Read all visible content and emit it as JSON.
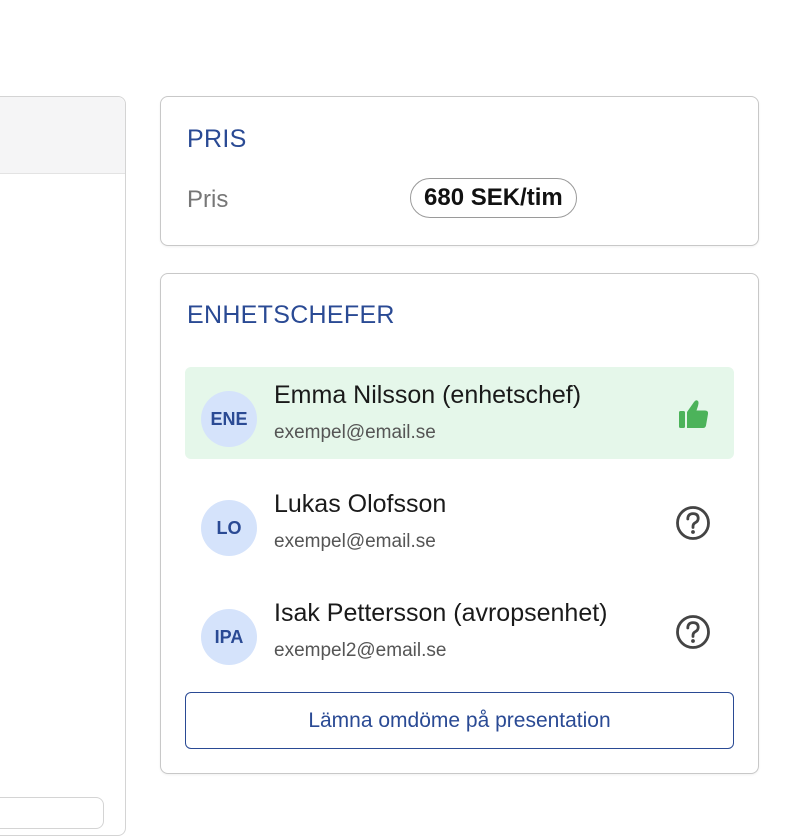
{
  "price_card": {
    "title": "PRIS",
    "label": "Pris",
    "value": "680 SEK/tim"
  },
  "managers_card": {
    "title": "ENHETSCHEFER",
    "managers": [
      {
        "initials": "ENE",
        "name": "Emma Nilsson (enhetschef)",
        "email": "exempel@email.se",
        "status": "approved",
        "status_icon": "thumbs-up-icon",
        "status_color": "#4cb35a"
      },
      {
        "initials": "LO",
        "name": "Lukas Olofsson",
        "email": "exempel@email.se",
        "status": "pending",
        "status_icon": "question-circle-icon",
        "status_color": "#444444"
      },
      {
        "initials": "IPA",
        "name": "Isak Pettersson (avropsenhet)",
        "email": "exempel2@email.se",
        "status": "pending",
        "status_icon": "question-circle-icon",
        "status_color": "#444444"
      }
    ],
    "review_button_label": "Lämna omdöme på presentation"
  },
  "colors": {
    "accent": "#2a4a94",
    "selected_row_bg": "#e5f7ea",
    "avatar_bg": "#d5e3fb",
    "approved": "#4cb35a"
  }
}
